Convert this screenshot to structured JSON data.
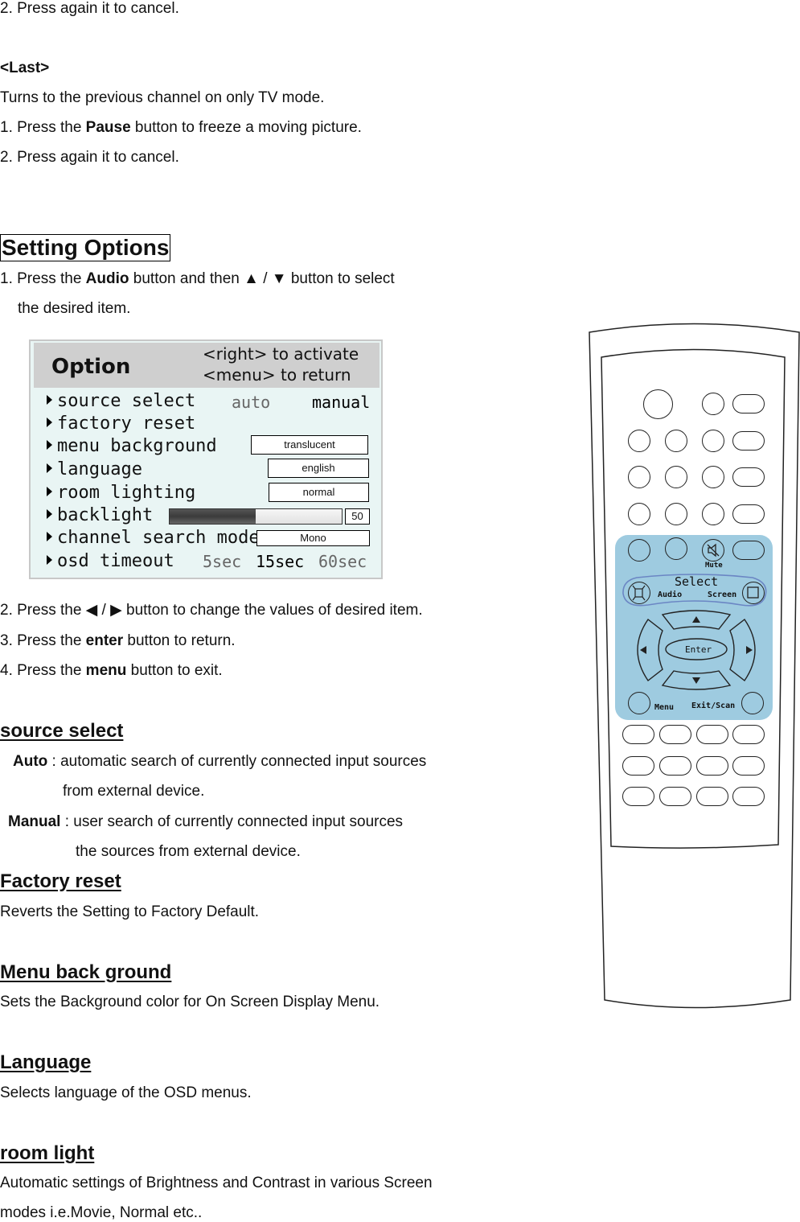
{
  "intro": {
    "line_cancel_1": "2. Press again it to cancel.",
    "last_heading": "<Last>",
    "last_desc": "Turns to the previous channel on only TV mode.",
    "pause_pre": "1. Press the ",
    "pause_bold": "Pause",
    "pause_post": " button to freeze a moving picture.",
    "line_cancel_2": "2. Press again it to cancel."
  },
  "setting": {
    "title": "Setting Options",
    "step1_pre": "1. Press the ",
    "step1_bold": "Audio",
    "step1_post": " button and then ▲ / ▼ button to select",
    "step1_cont": "the desired item.",
    "step2": "2. Press the ◀ / ▶ button to change the values of desired item.",
    "step3_pre": "3. Press the ",
    "step3_bold": "enter",
    "step3_post": " button to return.",
    "step4_pre": "4. Press the ",
    "step4_bold": "menu",
    "step4_post": " button to exit."
  },
  "osd": {
    "title": "Option",
    "hint_1": "<right> to activate",
    "hint_2": "<menu> to return",
    "items": [
      {
        "label": "source select"
      },
      {
        "label": "factory reset"
      },
      {
        "label": "menu background"
      },
      {
        "label": "language"
      },
      {
        "label": "room lighting"
      },
      {
        "label": "backlight"
      },
      {
        "label": "channel search mode"
      },
      {
        "label": "osd timeout"
      }
    ],
    "source_options": [
      "auto",
      "manual"
    ],
    "source_selected": "manual",
    "menu_background_value": "translucent",
    "language_value": "english",
    "room_lighting_value": "normal",
    "backlight_value": "50",
    "backlight_percent": 50,
    "channel_search_value": "Mono",
    "timeout_options": [
      "5sec",
      "15sec",
      "60sec"
    ],
    "timeout_selected": "15sec",
    "colors": {
      "header": "#cfcfcf",
      "body": "#e9f5f4",
      "dim_text": "#666666"
    }
  },
  "sections": {
    "source_select": {
      "heading": "source select",
      "auto_label": "Auto",
      "auto_desc": " : automatic search of currently connected input sources",
      "auto_cont": "from external device.",
      "manual_label": "Manual",
      "manual_desc": " : user search of currently connected input sources",
      "manual_cont": "the sources from external device."
    },
    "factory_reset": {
      "heading": "Factory reset",
      "desc": "Reverts the Setting to Factory Default."
    },
    "menu_background": {
      "heading": "Menu back ground",
      "desc": "Sets the Background color for On Screen Display Menu."
    },
    "language": {
      "heading": "Language",
      "desc": "Selects language of the OSD menus."
    },
    "room_light": {
      "heading": "room light",
      "desc_1": "Automatic settings of Brightness and Contrast in various Screen",
      "desc_2": "modes i.e.Movie, Normal etc.."
    }
  },
  "remote": {
    "mute_label": "Mute",
    "select_label": "Select",
    "audio_label": "Audio",
    "screen_label": "Screen",
    "enter_label": "Enter",
    "menu_label": "Menu",
    "exit_label": "Exit/Scan",
    "panel_color": "#9ecbe0"
  }
}
